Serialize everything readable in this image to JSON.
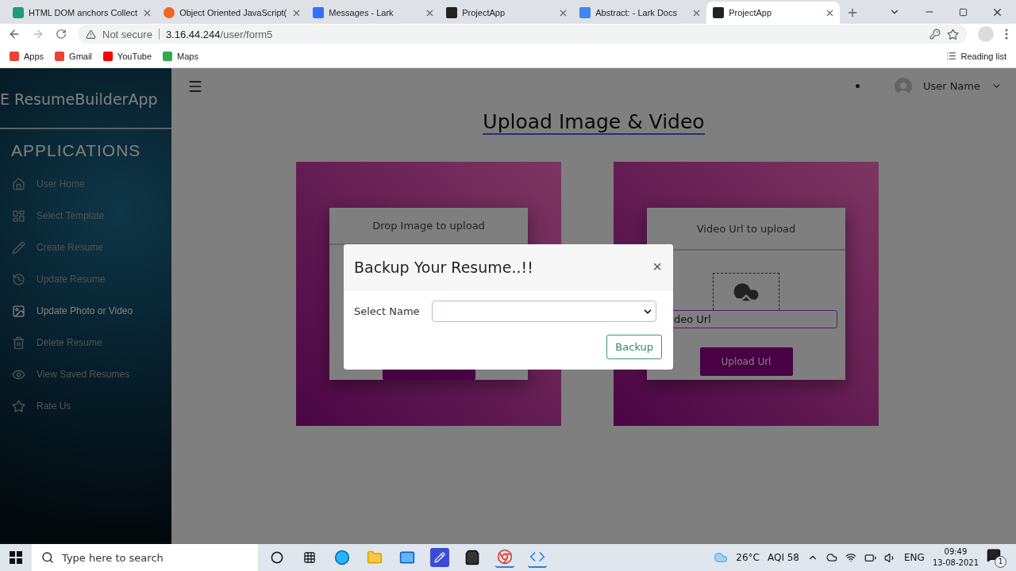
{
  "browser": {
    "tabs": [
      {
        "title": "HTML DOM anchors Collect",
        "selected": false
      },
      {
        "title": "Object Oriented JavaScript(",
        "selected": false
      },
      {
        "title": "Messages - Lark",
        "selected": false
      },
      {
        "title": "ProjectApp",
        "selected": false
      },
      {
        "title": "Abstract: - Lark Docs",
        "selected": false
      },
      {
        "title": "ProjectApp",
        "selected": true
      }
    ],
    "security": "Not secure",
    "url_host": "3.16.44.244",
    "url_path": "/user/form5",
    "bookmarks": [
      "Apps",
      "Gmail",
      "YouTube",
      "Maps"
    ],
    "reading_list": "Reading list"
  },
  "sidebar": {
    "brand": "E ResumeBuilderApp",
    "heading": "APPLICATIONS",
    "items": [
      {
        "label": "User Home",
        "selected": false
      },
      {
        "label": "Select Template",
        "selected": false
      },
      {
        "label": "Create Resume",
        "selected": false
      },
      {
        "label": "Update Resume",
        "selected": false
      },
      {
        "label": "Update Photo or Video",
        "selected": true
      },
      {
        "label": "Delete Resume",
        "selected": false
      },
      {
        "label": "View Saved Resumes",
        "selected": false
      },
      {
        "label": "Rate Us",
        "selected": false
      }
    ]
  },
  "header": {
    "user_name": "User Name"
  },
  "page_title": "Upload Image & Video",
  "cards": [
    {
      "kind": "image",
      "heading": "Drop Image to upload"
    },
    {
      "kind": "video",
      "heading": "Video Url to upload",
      "input_value": "deo Url",
      "button": "Upload Url"
    }
  ],
  "modal": {
    "title": "Backup Your Resume..!!",
    "close": "×",
    "field_label": "Select Name",
    "button": "Backup"
  },
  "taskbar": {
    "search_placeholder": "Type here to search",
    "weather": "26°C",
    "aqi": "AQI 58",
    "language": "ENG",
    "time": "09:49",
    "date": "13-08-2021",
    "notifications": "1"
  }
}
